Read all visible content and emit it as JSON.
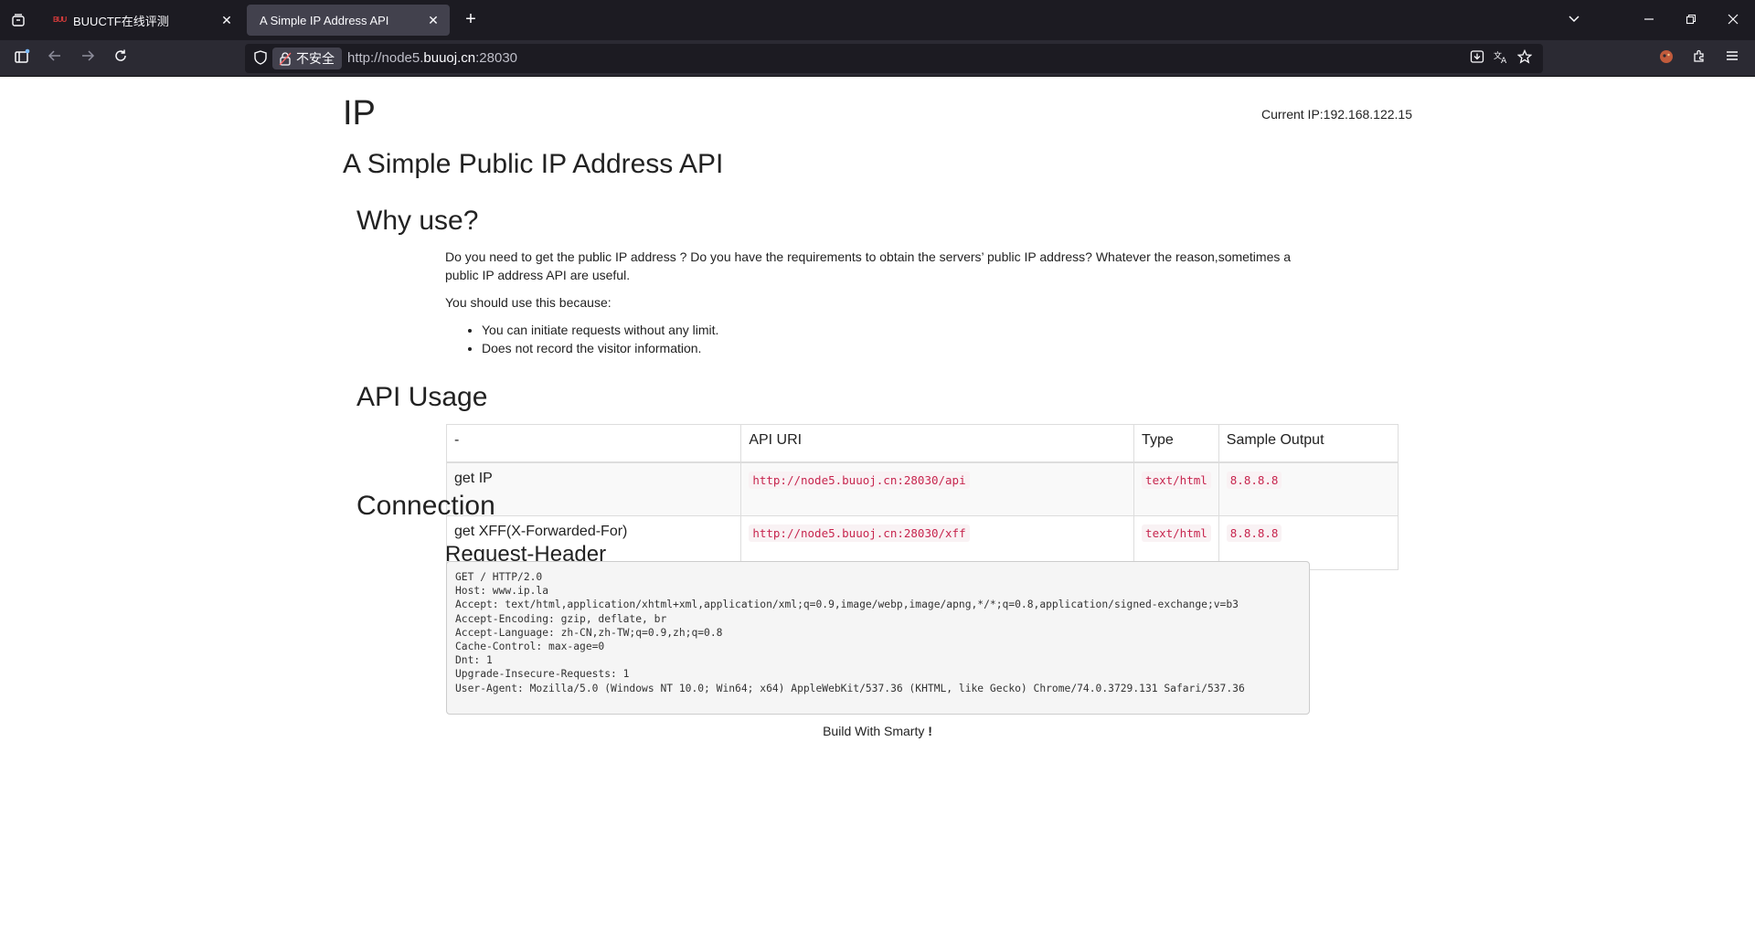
{
  "browser": {
    "tabs": [
      {
        "title": "BUUCTF在线评测",
        "favicon": "BUU"
      },
      {
        "title": "A Simple IP Address API"
      }
    ],
    "address_bar": {
      "security_label": "不安全",
      "url_prefix": "http://node5.",
      "url_domain": "buuoj.cn",
      "url_suffix": ":28030"
    }
  },
  "page": {
    "brand": "IP",
    "current_ip": "Current IP:192.168.122.15",
    "subtitle": "A Simple Public IP Address API",
    "why": {
      "heading": "Why use?",
      "paragraph": "Do you need to get the public IP address ? Do you have the requirements to obtain the servers’ public IP address? Whatever the reason,sometimes a public IP address API are useful.",
      "lead": "You should use this because:",
      "reasons": [
        "You can initiate requests without any limit.",
        "Does not record the visitor information."
      ]
    },
    "usage": {
      "heading": "API Usage",
      "columns": [
        "-",
        "API URI",
        "Type",
        "Sample Output"
      ],
      "rows": [
        {
          "name": "get IP",
          "uri": "http://node5.buuoj.cn:28030/api",
          "type": "text/html",
          "sample": "8.8.8.8"
        },
        {
          "name": "get XFF(X-Forwarded-For)",
          "uri": "http://node5.buuoj.cn:28030/xff",
          "type": "text/html",
          "sample": "8.8.8.8"
        }
      ]
    },
    "connection": {
      "heading": "Connection",
      "subheading": "Request-Header",
      "header_lines": [
        "GET / HTTP/2.0",
        "Host: www.ip.la",
        "Accept: text/html,application/xhtml+xml,application/xml;q=0.9,image/webp,image/apng,*/*;q=0.8,application/signed-exchange;v=b3",
        "Accept-Encoding: gzip, deflate, br",
        "Accept-Language: zh-CN,zh-TW;q=0.9,zh;q=0.8",
        "Cache-Control: max-age=0",
        "Dnt: 1",
        "Upgrade-Insecure-Requests: 1",
        "User-Agent: Mozilla/5.0 (Windows NT 10.0; Win64; x64) AppleWebKit/537.36 (KHTML, like Gecko) Chrome/74.0.3729.131 Safari/537.36"
      ]
    },
    "footer": {
      "text": "Build With Smarty",
      "mark": "!"
    }
  }
}
